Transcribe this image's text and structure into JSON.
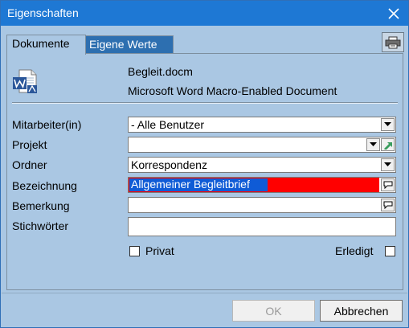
{
  "window": {
    "title": "Eigenschaften"
  },
  "tabs": [
    {
      "label": "Dokumente"
    },
    {
      "label": "Eigene Werte"
    }
  ],
  "file": {
    "name": "Begleit.docm",
    "type": "Microsoft Word Macro-Enabled Document"
  },
  "fields": {
    "mitarbeiter": {
      "label": "Mitarbeiter(in)",
      "value": "- Alle Benutzer"
    },
    "projekt": {
      "label": "Projekt",
      "value": ""
    },
    "ordner": {
      "label": "Ordner",
      "value": "Korrespondenz"
    },
    "bezeichnung": {
      "label": "Bezeichnung",
      "value": "Allgemeiner Begleitbrief"
    },
    "bemerkung": {
      "label": "Bemerkung",
      "value": ""
    },
    "stichwoerter": {
      "label": "Stichwörter",
      "value": ""
    }
  },
  "checkboxes": {
    "privat": {
      "label": "Privat",
      "checked": false
    },
    "erledigt": {
      "label": "Erledigt",
      "checked": false
    }
  },
  "buttons": {
    "ok": "OK",
    "cancel": "Abbrechen"
  },
  "icons": {
    "close": "close-icon",
    "print": "printer-icon",
    "document": "word-document-icon",
    "dropdown": "chevron-down-icon",
    "link": "arrow-icon",
    "comment": "speech-bubble-icon"
  },
  "colors": {
    "titlebar": "#1e78d4",
    "dialog_bg": "#aac7e3",
    "active_tab": "#aac7e3",
    "inactive_tab": "#2d6fb0",
    "highlight_red": "#ff0000",
    "selection_blue": "#0f5bd6"
  }
}
